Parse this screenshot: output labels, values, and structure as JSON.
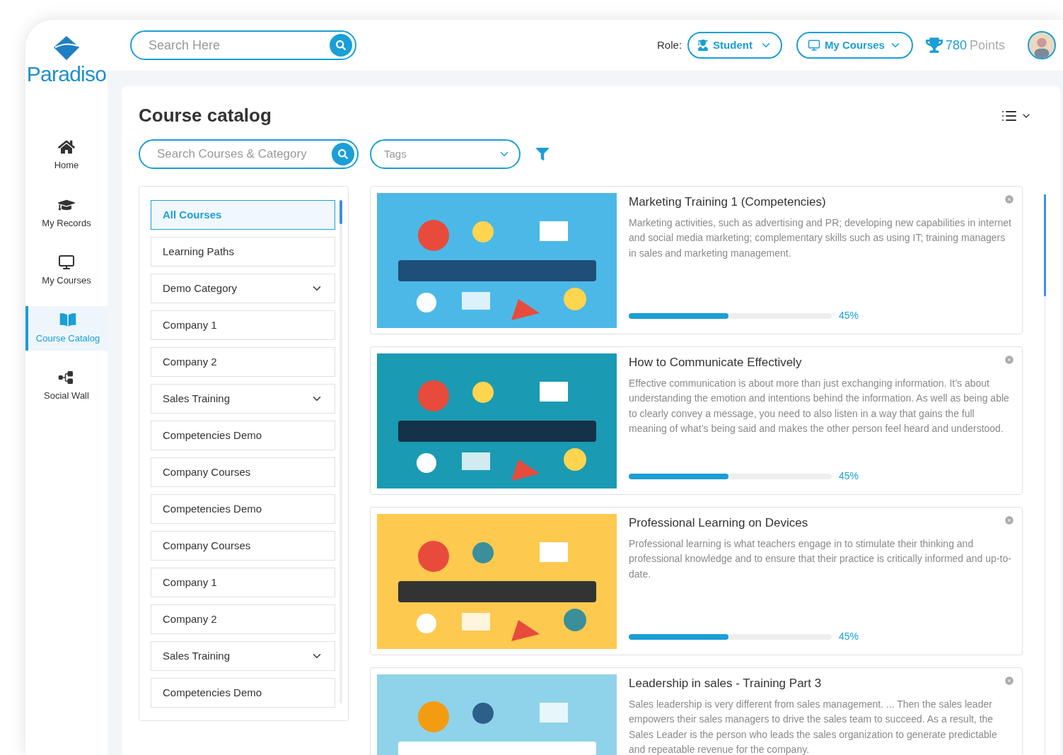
{
  "brand": {
    "name": "Paradiso"
  },
  "top_search": {
    "placeholder": "Search Here"
  },
  "role": {
    "label": "Role:",
    "value": "Student"
  },
  "my_courses_menu": {
    "label": "My Courses"
  },
  "points": {
    "value": "780",
    "label": "Points"
  },
  "nav": [
    {
      "label": "Home",
      "kind": "home",
      "selected": false
    },
    {
      "label": "My Records",
      "kind": "records",
      "selected": false
    },
    {
      "label": "My Courses",
      "kind": "courses",
      "selected": false
    },
    {
      "label": "Course Catalog",
      "kind": "catalog",
      "selected": true
    },
    {
      "label": "Social Wall",
      "kind": "social",
      "selected": false
    }
  ],
  "page_title": "Course catalog",
  "catalog_search": {
    "placeholder": "Search Courses & Category"
  },
  "tags_select": {
    "placeholder": "Tags"
  },
  "categories": [
    {
      "label": "All Courses",
      "selected": true,
      "expandable": false
    },
    {
      "label": "Learning Paths",
      "selected": false,
      "expandable": false
    },
    {
      "label": "Demo Category",
      "selected": false,
      "expandable": true
    },
    {
      "label": "Company 1",
      "selected": false,
      "expandable": false
    },
    {
      "label": "Company 2",
      "selected": false,
      "expandable": false
    },
    {
      "label": "Sales Training",
      "selected": false,
      "expandable": true
    },
    {
      "label": "Competencies Demo",
      "selected": false,
      "expandable": false
    },
    {
      "label": "Company Courses",
      "selected": false,
      "expandable": false
    },
    {
      "label": "Competencies Demo",
      "selected": false,
      "expandable": false
    },
    {
      "label": "Company Courses",
      "selected": false,
      "expandable": false
    },
    {
      "label": "Company 1",
      "selected": false,
      "expandable": false
    },
    {
      "label": "Company 2",
      "selected": false,
      "expandable": false
    },
    {
      "label": "Sales Training",
      "selected": false,
      "expandable": true
    },
    {
      "label": "Competencies Demo",
      "selected": false,
      "expandable": false
    }
  ],
  "courses": [
    {
      "title": "Marketing Training 1 (Competencies)",
      "description": "Marketing activities, such as advertising and PR; developing new capabilities in internet and social media marketing; complementary skills such as using IT; training managers in sales and marketing management.",
      "level": 0.49,
      "reading": "45%"
    },
    {
      "title": "How to Communicate Effectively",
      "description": "Effective communication is about more than just exchanging information. It’s about understanding the emotion and intentions behind the information. As well as being able to clearly convey a message, you need to also listen in a way that gains the full meaning of what’s being said and makes the other person feel heard and understood.",
      "level": 0.49,
      "reading": "45%"
    },
    {
      "title": "Professional Learning on Devices",
      "description": "Professional learning is what teachers engage in to stimulate their thinking and professional knowledge and to ensure that their practice is critically informed and up-to-date.",
      "level": 0.49,
      "reading": "45%"
    },
    {
      "title": "Leadership in sales - Training Part 3",
      "description": "Sales leadership is very different from sales management. ... Then the sales leader empowers their sales managers to drive the sales team to succeed. As a result, the Sales Leader is the person who leads the sales organization to generate predictable and repeatable revenue for the company."
    }
  ]
}
